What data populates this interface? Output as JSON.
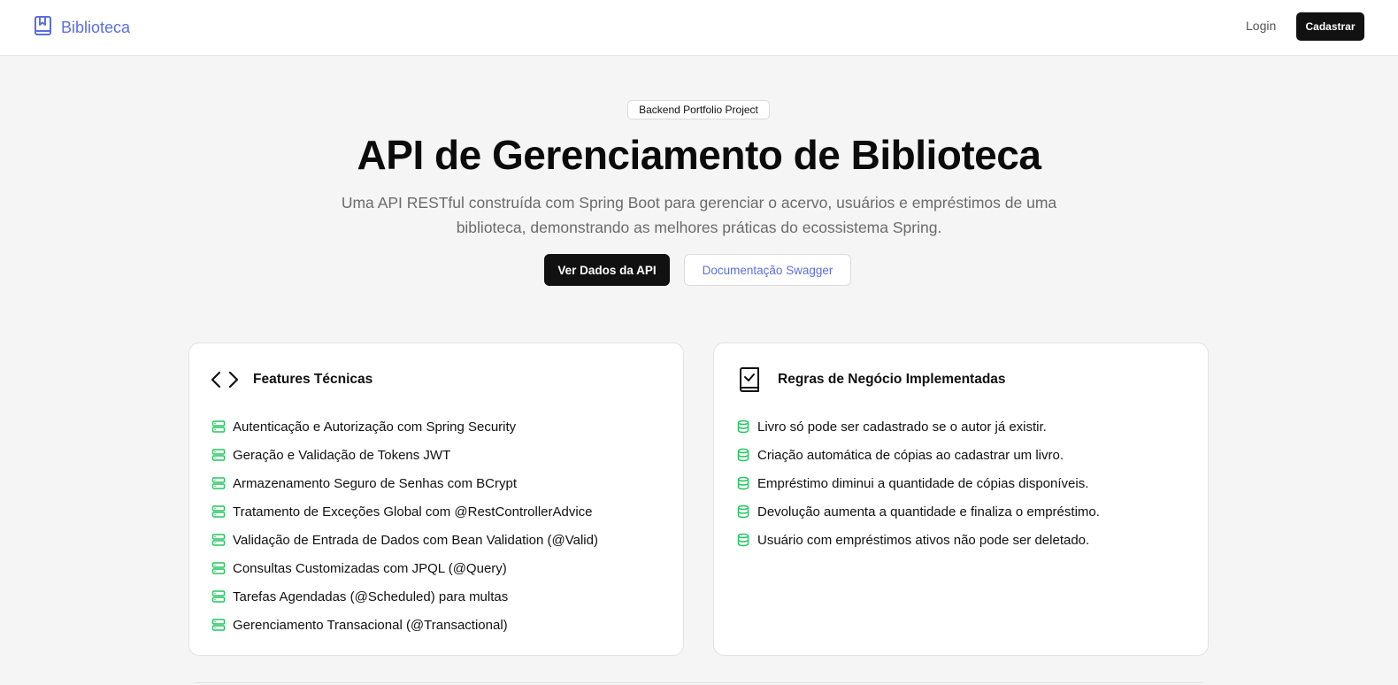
{
  "nav": {
    "brand": "Biblioteca",
    "brand_icon": "bookmark-book-icon",
    "login": "Login",
    "signup": "Cadastrar"
  },
  "hero": {
    "badge": "Backend Portfolio Project",
    "title": "API de Gerenciamento de Biblioteca",
    "subtitle": "Uma API RESTful construída com Spring Boot para gerenciar o acervo, usuários e empréstimos de uma biblioteca, demonstrando as melhores práticas do ecossistema Spring.",
    "primary_button": "Ver Dados da API",
    "secondary_button": "Documentação Swagger"
  },
  "features_card": {
    "icon": "code-icon",
    "title": "Features Técnicas",
    "item_icon": "server-icon",
    "items": [
      "Autenticação e Autorização com Spring Security",
      "Geração e Validação de Tokens JWT",
      "Armazenamento Seguro de Senhas com BCrypt",
      "Tratamento de Exceções Global com @RestControllerAdvice",
      "Validação de Entrada de Dados com Bean Validation (@Valid)",
      "Consultas Customizadas com JPQL (@Query)",
      "Tarefas Agendadas (@Scheduled) para multas",
      "Gerenciamento Transacional (@Transactional)"
    ]
  },
  "rules_card": {
    "icon": "book-check-icon",
    "title": "Regras de Negócio Implementadas",
    "item_icon": "database-icon",
    "items": [
      "Livro só pode ser cadastrado se o autor já existir.",
      "Criação automática de cópias ao cadastrar um livro.",
      "Empréstimo diminui a quantidade de cópias disponíveis.",
      "Devolução aumenta a quantidade e finaliza o empréstimo.",
      "Usuário com empréstimos ativos não pode ser deletado."
    ]
  },
  "colors": {
    "accent": "#5b6ee1",
    "list_icon": "#22c55e",
    "dark": "#111111"
  }
}
